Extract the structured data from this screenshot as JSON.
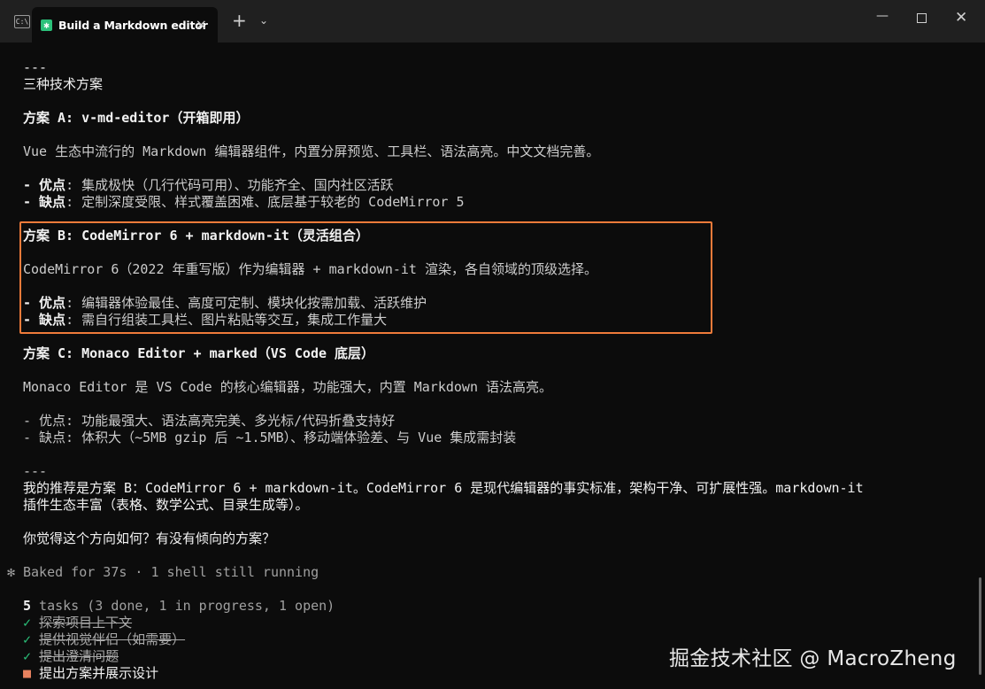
{
  "window": {
    "tab_title": "Build a Markdown editor",
    "tab_close": "×",
    "new_tab": "+",
    "dropdown": "⌄",
    "minimize": "—",
    "close": "✕",
    "app_icon_text": "C:\\"
  },
  "terminal": {
    "sep1": "---",
    "heading": "三种技术方案",
    "a_title": "方案 A: v-md-editor（开箱即用）",
    "a_desc": "Vue 生态中流行的 Markdown 编辑器组件，内置分屏预览、工具栏、语法高亮。中文文档完善。",
    "a_pro_label": "- 优点",
    "a_pro": ": 集成极快（几行代码可用）、功能齐全、国内社区活跃",
    "a_con_label": "- 缺点",
    "a_con": ": 定制深度受限、样式覆盖困难、底层基于较老的 CodeMirror 5",
    "b_title": "方案 B: CodeMirror 6 + markdown-it（灵活组合）",
    "b_desc": "CodeMirror 6（2022 年重写版）作为编辑器 + markdown-it 渲染，各自领域的顶级选择。",
    "b_pro_label": "- 优点",
    "b_pro": ": 编辑器体验最佳、高度可定制、模块化按需加载、活跃维护",
    "b_con_label": "- 缺点",
    "b_con": ": 需自行组装工具栏、图片粘贴等交互，集成工作量大",
    "c_title": "方案 C: Monaco Editor + marked（VS Code 底层）",
    "c_desc": "Monaco Editor 是 VS Code 的核心编辑器，功能强大，内置 Markdown 语法高亮。",
    "c_pro": "- 优点: 功能最强大、语法高亮完美、多光标/代码折叠支持好",
    "c_con": "- 缺点: 体积大（~5MB gzip 后 ~1.5MB）、移动端体验差、与 Vue 集成需封装",
    "sep2": "---",
    "rec1": "我的推荐是方案 B：CodeMirror 6 + markdown-it。CodeMirror 6 是现代编辑器的事实标准，架构干净、可扩展性强。markdown-it",
    "rec2": "插件生态丰富（表格、数学公式、目录生成等）。",
    "question": "你觉得这个方向如何？有没有倾向的方案？",
    "spinner": "✻",
    "status": "Baked for 37s · 1 shell still running",
    "tasks_count": "5",
    "tasks_summary": " tasks (3 done, 1 in progress, 1 open)",
    "tasks": [
      {
        "mark": "✓",
        "label": "探索项目上下文"
      },
      {
        "mark": "✓",
        "label": "提供视觉伴侣（如需要）"
      },
      {
        "mark": "✓",
        "label": "提出澄清问题"
      },
      {
        "mark": "■",
        "label": "提出方案并展示设计"
      }
    ]
  },
  "watermark": "掘金技术社区 @ MacroZheng",
  "colors": {
    "highlight_border": "#ef7b3a",
    "done_check": "#2bc17a",
    "in_progress": "#e8825f"
  }
}
